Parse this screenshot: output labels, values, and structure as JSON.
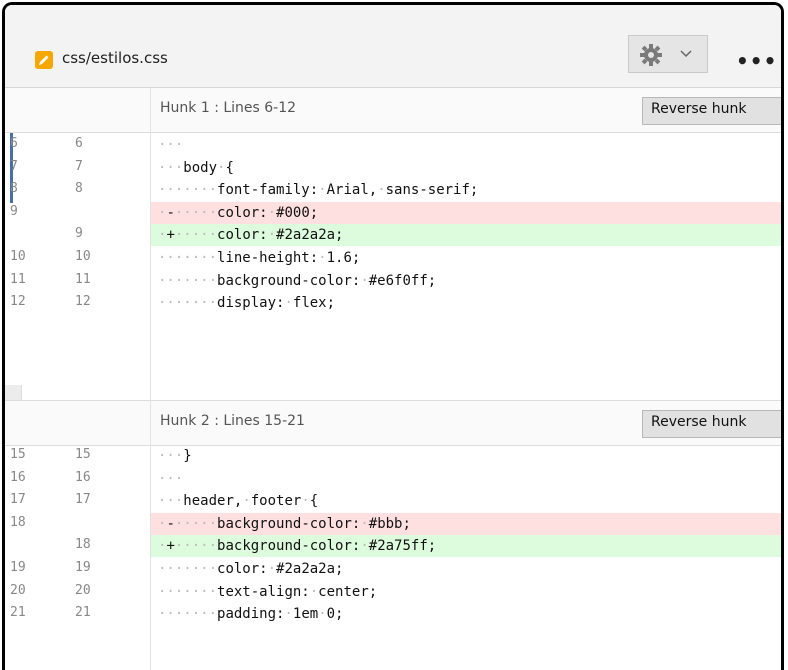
{
  "header": {
    "file_name": "css/estilos.css",
    "settings_chevron": "⌄",
    "more_label": "•••"
  },
  "hunks": [
    {
      "title": "Hunk 1 : Lines 6-12",
      "reverse_label": "Reverse hunk",
      "lines": [
        {
          "type": "ctx",
          "old": "6",
          "new": "6",
          "ws": "···",
          "text": ""
        },
        {
          "type": "ctx",
          "old": "7",
          "new": "7",
          "ws": "···",
          "text": "body·{"
        },
        {
          "type": "ctx",
          "old": "8",
          "new": "8",
          "ws": "·······",
          "text": "font-family:·Arial,·sans-serif;"
        },
        {
          "type": "del",
          "old": "9",
          "new": "",
          "ws": "·-·····",
          "text": "color:·#000;"
        },
        {
          "type": "add",
          "old": "",
          "new": "9",
          "ws": "·+·····",
          "text": "color:·#2a2a2a;"
        },
        {
          "type": "ctx",
          "old": "10",
          "new": "10",
          "ws": "·······",
          "text": "line-height:·1.6;"
        },
        {
          "type": "ctx",
          "old": "11",
          "new": "11",
          "ws": "·······",
          "text": "background-color:·#e6f0ff;"
        },
        {
          "type": "ctx",
          "old": "12",
          "new": "12",
          "ws": "·······",
          "text": "display:·flex;"
        }
      ]
    },
    {
      "title": "Hunk 2 : Lines 15-21",
      "reverse_label": "Reverse hunk",
      "lines": [
        {
          "type": "ctx",
          "old": "15",
          "new": "15",
          "ws": "···",
          "text": "}"
        },
        {
          "type": "ctx",
          "old": "16",
          "new": "16",
          "ws": "···",
          "text": ""
        },
        {
          "type": "ctx",
          "old": "17",
          "new": "17",
          "ws": "···",
          "text": "header,·footer·{"
        },
        {
          "type": "del",
          "old": "18",
          "new": "",
          "ws": "·-·····",
          "text": "background-color:·#bbb;"
        },
        {
          "type": "add",
          "old": "",
          "new": "18",
          "ws": "·+·····",
          "text": "background-color:·#2a75ff;"
        },
        {
          "type": "ctx",
          "old": "19",
          "new": "19",
          "ws": "·······",
          "text": "color:·#2a2a2a;"
        },
        {
          "type": "ctx",
          "old": "20",
          "new": "20",
          "ws": "·······",
          "text": "text-align:·center;"
        },
        {
          "type": "ctx",
          "old": "21",
          "new": "21",
          "ws": "·······",
          "text": "padding:·1em·0;"
        }
      ]
    }
  ],
  "colors": {
    "deleted_bg": "#ffe0e0",
    "added_bg": "#ddfbdd",
    "file_icon": "#f6a800"
  },
  "icons": [
    "pencil-icon",
    "gear-icon",
    "chevron-down-icon",
    "more-icon"
  ]
}
